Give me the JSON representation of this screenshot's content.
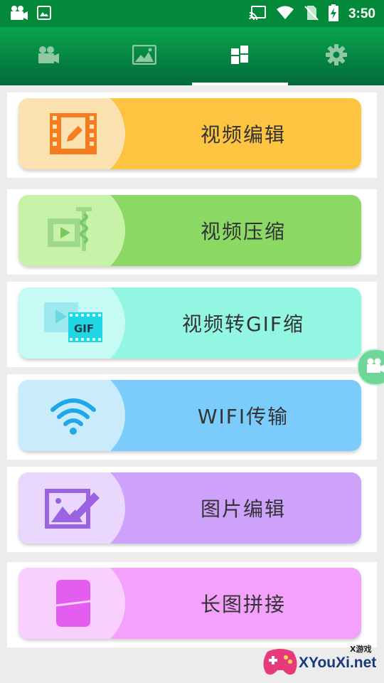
{
  "status_bar": {
    "time": "3:50",
    "left_icons": [
      "video-camera-icon",
      "image-icon"
    ],
    "right_icons": [
      "cast-icon",
      "wifi-icon",
      "no-sim-icon",
      "battery-charging-icon"
    ]
  },
  "tabs": [
    {
      "icon": "video-camera-icon"
    },
    {
      "icon": "image-landscape-icon"
    },
    {
      "icon": "grid-tiles-icon",
      "selected": true
    },
    {
      "icon": "gear-icon"
    }
  ],
  "menu": [
    {
      "label": "视频编辑",
      "icon": "video-edit-icon",
      "color": "#fcc440",
      "cap": "#fde2b1"
    },
    {
      "label": "视频压缩",
      "icon": "video-compress-icon",
      "color": "#8bd964",
      "cap": "#c7f3a8"
    },
    {
      "label": "视频转GIF缩",
      "icon": "video-to-gif-icon",
      "color": "#92f6e3",
      "cap": "#c6fbf5"
    },
    {
      "label": "WIFI传输",
      "icon": "wifi-icon",
      "color": "#7cccfb",
      "cap": "#c9ebfb"
    },
    {
      "label": "图片编辑",
      "icon": "image-edit-icon",
      "color": "#cea1fb",
      "cap": "#ead7fd"
    },
    {
      "label": "长图拼接",
      "icon": "long-image-stitch-icon",
      "color": "#f3a1fb",
      "cap": "#f9cffd"
    }
  ],
  "watermark": {
    "small": "X游戏",
    "big": "XYouXi.net"
  }
}
